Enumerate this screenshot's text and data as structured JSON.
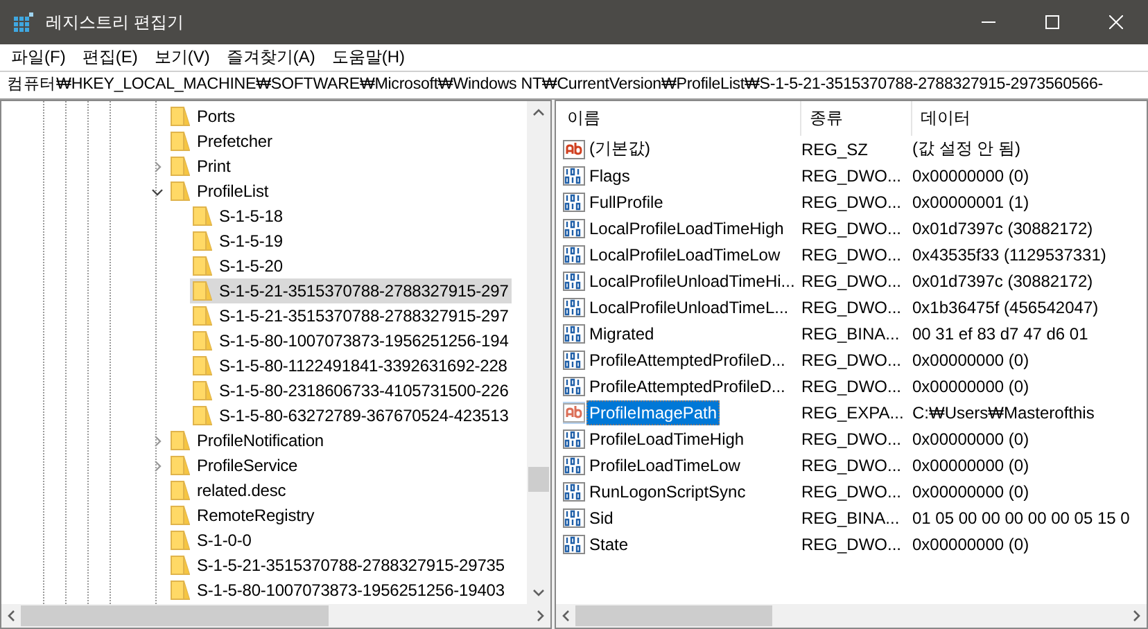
{
  "window": {
    "title": "레지스트리 편집기"
  },
  "menu": [
    "파일(F)",
    "편집(E)",
    "보기(V)",
    "즐겨찾기(A)",
    "도움말(H)"
  ],
  "address": "컴퓨터₩HKEY_LOCAL_MACHINE₩SOFTWARE₩Microsoft₩Windows NT₩CurrentVersion₩ProfileList₩S-1-5-21-3515370788-2788327915-2973560566-",
  "tree": [
    {
      "label": "Ports",
      "selected": false
    },
    {
      "label": "Prefetcher",
      "selected": false
    },
    {
      "label": "Print",
      "expanded": false,
      "selected": false
    },
    {
      "label": "ProfileList",
      "expanded": true,
      "selected": false,
      "children": [
        {
          "label": "S-1-5-18",
          "selected": false
        },
        {
          "label": "S-1-5-19",
          "selected": false
        },
        {
          "label": "S-1-5-20",
          "selected": false
        },
        {
          "label": "S-1-5-21-3515370788-2788327915-297",
          "selected": true
        },
        {
          "label": "S-1-5-21-3515370788-2788327915-297",
          "selected": false
        },
        {
          "label": "S-1-5-80-1007073873-1956251256-194",
          "selected": false
        },
        {
          "label": "S-1-5-80-1122491841-3392631692-228",
          "selected": false
        },
        {
          "label": "S-1-5-80-2318606733-4105731500-226",
          "selected": false
        },
        {
          "label": "S-1-5-80-63272789-367670524-423513",
          "selected": false
        }
      ]
    },
    {
      "label": "ProfileNotification",
      "expanded": false,
      "selected": false
    },
    {
      "label": "ProfileService",
      "expanded": false,
      "selected": false
    },
    {
      "label": "related.desc",
      "selected": false
    },
    {
      "label": "RemoteRegistry",
      "selected": false
    },
    {
      "label": "S-1-0-0",
      "selected": false
    },
    {
      "label": "S-1-5-21-3515370788-2788327915-29735",
      "selected": false
    },
    {
      "label": "S-1-5-80-1007073873-1956251256-19403",
      "selected": false
    }
  ],
  "table": {
    "columns": [
      "이름",
      "종류",
      "데이터"
    ],
    "rows": [
      {
        "kind": "string",
        "name": "(기본값)",
        "type": "REG_SZ",
        "data": "(값 설정 안 됨)",
        "selected": false
      },
      {
        "kind": "binary",
        "name": "Flags",
        "type": "REG_DWO...",
        "data": "0x00000000 (0)",
        "selected": false
      },
      {
        "kind": "binary",
        "name": "FullProfile",
        "type": "REG_DWO...",
        "data": "0x00000001 (1)",
        "selected": false
      },
      {
        "kind": "binary",
        "name": "LocalProfileLoadTimeHigh",
        "type": "REG_DWO...",
        "data": "0x01d7397c (30882172)",
        "selected": false
      },
      {
        "kind": "binary",
        "name": "LocalProfileLoadTimeLow",
        "type": "REG_DWO...",
        "data": "0x43535f33 (1129537331)",
        "selected": false
      },
      {
        "kind": "binary",
        "name": "LocalProfileUnloadTimeHi...",
        "type": "REG_DWO...",
        "data": "0x01d7397c (30882172)",
        "selected": false
      },
      {
        "kind": "binary",
        "name": "LocalProfileUnloadTimeL...",
        "type": "REG_DWO...",
        "data": "0x1b36475f (456542047)",
        "selected": false
      },
      {
        "kind": "binary",
        "name": "Migrated",
        "type": "REG_BINA...",
        "data": "00 31 ef 83 d7 47 d6 01",
        "selected": false
      },
      {
        "kind": "binary",
        "name": "ProfileAttemptedProfileD...",
        "type": "REG_DWO...",
        "data": "0x00000000 (0)",
        "selected": false
      },
      {
        "kind": "binary",
        "name": "ProfileAttemptedProfileD...",
        "type": "REG_DWO...",
        "data": "0x00000000 (0)",
        "selected": false
      },
      {
        "kind": "string",
        "name": "ProfileImagePath",
        "type": "REG_EXPA...",
        "data": "C:₩Users₩Masterofthis",
        "selected": true
      },
      {
        "kind": "binary",
        "name": "ProfileLoadTimeHigh",
        "type": "REG_DWO...",
        "data": "0x00000000 (0)",
        "selected": false
      },
      {
        "kind": "binary",
        "name": "ProfileLoadTimeLow",
        "type": "REG_DWO...",
        "data": "0x00000000 (0)",
        "selected": false
      },
      {
        "kind": "binary",
        "name": "RunLogonScriptSync",
        "type": "REG_DWO...",
        "data": "0x00000000 (0)",
        "selected": false
      },
      {
        "kind": "binary",
        "name": "Sid",
        "type": "REG_BINA...",
        "data": "01 05 00 00 00 00 00 05 15 0",
        "selected": false
      },
      {
        "kind": "binary",
        "name": "State",
        "type": "REG_DWO...",
        "data": "0x00000000 (0)",
        "selected": false
      }
    ]
  }
}
